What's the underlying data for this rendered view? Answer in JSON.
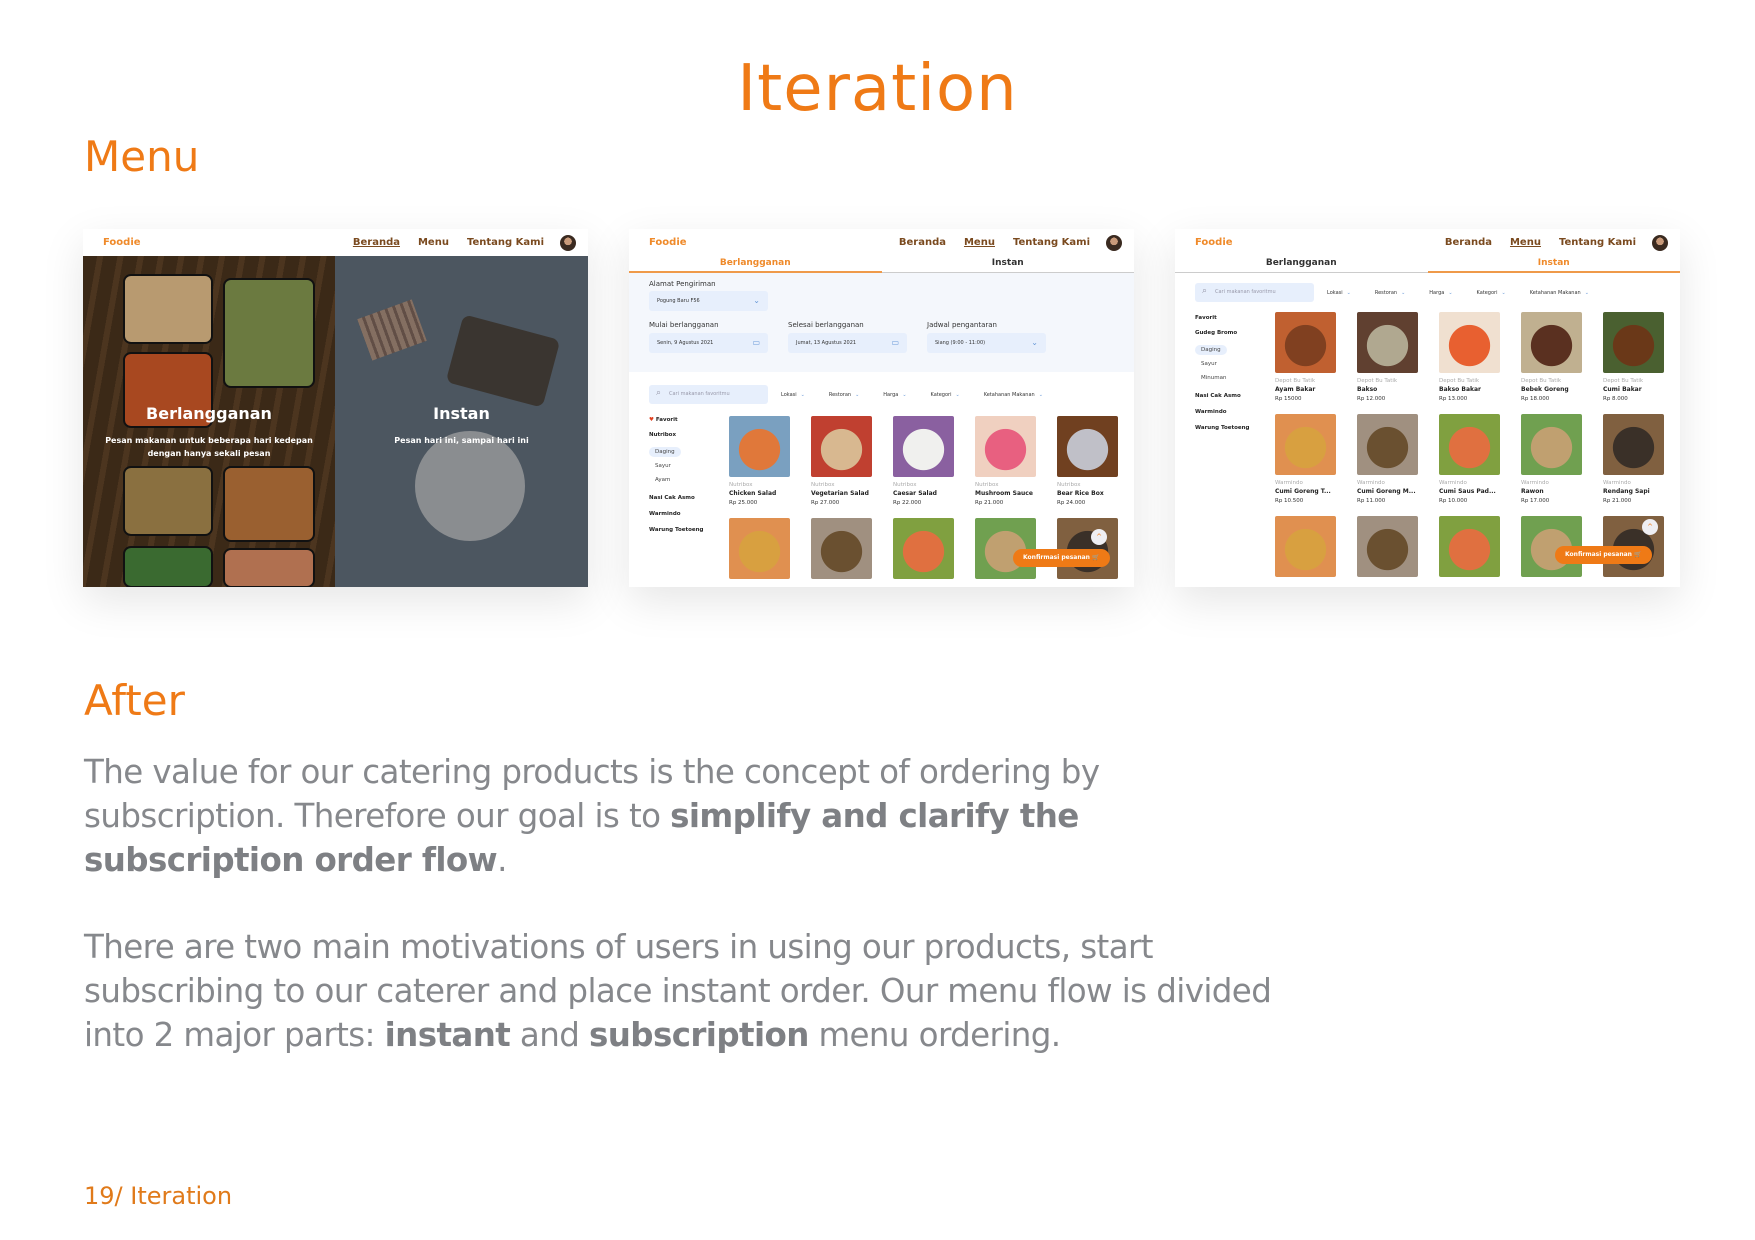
{
  "page": {
    "title": "Iteration",
    "section_menu": "Menu",
    "section_after": "After",
    "footer": "19/ Iteration",
    "accent_color": "#ef7a16"
  },
  "paragraph1": {
    "part1": "The value for our catering products is the concept of ordering by subscription. Therefore our goal is to ",
    "bold1": "simplify and clarify the subscription order flow",
    "part2": "."
  },
  "paragraph2": {
    "part1": "There are two main motivations of users in using our products, start subscribing to our caterer and place instant order. Our menu flow is divided into 2 major parts: ",
    "bold1": "instant",
    "part2": " and ",
    "bold2": "subscription",
    "part3": " menu ordering."
  },
  "app": {
    "logo": "Foodie",
    "nav": [
      "Beranda",
      "Menu",
      "Tentang Kami"
    ],
    "avatar_icon": "user-avatar"
  },
  "screen1": {
    "active_nav": "Beranda",
    "left": {
      "title": "Berlangganan",
      "subtitle": "Pesan makanan untuk beberapa hari kedepan dengan hanya sekali pesan"
    },
    "right": {
      "title": "Instan",
      "subtitle": "Pesan hari ini, sampai hari ini"
    }
  },
  "screen2": {
    "active_nav": "Menu",
    "tabs": [
      "Berlangganan",
      "Instan"
    ],
    "active_tab": "Berlangganan",
    "form": {
      "address_label": "Alamat Pengiriman",
      "address_value": "Pogung Baru F56",
      "start_label": "Mulai berlangganan",
      "start_value": "Senin, 9 Agustus 2021",
      "end_label": "Selesai berlangganan",
      "end_value": "Jumat, 13 Agustus 2021",
      "schedule_label": "Jadwal pengantaran",
      "schedule_value": "Siang (9:00 - 11:00)"
    },
    "search_placeholder": "Cari makanan favoritmu",
    "filters": [
      "Lokasi",
      "Restoran",
      "Harga",
      "Kategori",
      "Ketahanan Makanan"
    ],
    "sidebar": {
      "favorite": "Favorit",
      "groups": [
        {
          "name": "Nutribox",
          "subs": [
            "Daging",
            "Sayur",
            "Ayam"
          ],
          "selected": "Daging"
        },
        {
          "name": "Nasi Cak Asmo",
          "subs": []
        },
        {
          "name": "Warmindo",
          "subs": []
        },
        {
          "name": "Warung Toetoeng",
          "subs": []
        }
      ]
    },
    "products": [
      {
        "restaurant": "Nutribox",
        "name": "Chicken Salad",
        "price": "Rp 25.000"
      },
      {
        "restaurant": "Nutribox",
        "name": "Vegetarian Salad",
        "price": "Rp 27.000"
      },
      {
        "restaurant": "Nutribox",
        "name": "Caesar Salad",
        "price": "Rp 22.000"
      },
      {
        "restaurant": "Nutribox",
        "name": "Mushroom Sauce",
        "price": "Rp 21.000"
      },
      {
        "restaurant": "Nutribox",
        "name": "Bear Rice Box",
        "price": "Rp 24.000"
      }
    ],
    "confirm_label": "Konfirmasi pesanan"
  },
  "screen3": {
    "active_nav": "Menu",
    "tabs": [
      "Berlangganan",
      "Instan"
    ],
    "active_tab": "Instan",
    "search_placeholder": "Cari makanan favoritmu",
    "filters": [
      "Lokasi",
      "Restoran",
      "Harga",
      "Kategori",
      "Ketahanan Makanan"
    ],
    "sidebar": {
      "favorite": "Favorit",
      "groups": [
        {
          "name": "Gudeg Bromo",
          "subs": [
            "Daging",
            "Sayur",
            "Minuman"
          ],
          "selected": "Daging"
        },
        {
          "name": "Nasi Cak Asmo",
          "subs": []
        },
        {
          "name": "Warmindo",
          "subs": []
        },
        {
          "name": "Warung Toetoeng",
          "subs": []
        }
      ]
    },
    "products": [
      {
        "restaurant": "Depot Bu Tatik",
        "name": "Ayam Bakar",
        "price": "Rp 15000"
      },
      {
        "restaurant": "Depot Bu Tatik",
        "name": "Bakso",
        "price": "Rp 12.000"
      },
      {
        "restaurant": "Depot Bu Tatik",
        "name": "Bakso Bakar",
        "price": "Rp 13.000"
      },
      {
        "restaurant": "Depot Bu Tatik",
        "name": "Bebek Goreng",
        "price": "Rp 18.000"
      },
      {
        "restaurant": "Depot Bu Tatik",
        "name": "Cumi Bakar",
        "price": "Rp 8.000"
      },
      {
        "restaurant": "Warmindo",
        "name": "Cumi Goreng T...",
        "price": "Rp 10.500"
      },
      {
        "restaurant": "Warmindo",
        "name": "Cumi Goreng M...",
        "price": "Rp 11.000"
      },
      {
        "restaurant": "Warmindo",
        "name": "Cumi Saus Pad...",
        "price": "Rp 10.000"
      },
      {
        "restaurant": "Warmindo",
        "name": "Rawon",
        "price": "Rp 17.000"
      },
      {
        "restaurant": "Warmindo",
        "name": "Rendang Sapi",
        "price": "Rp 21.000"
      }
    ],
    "confirm_label": "Konfirmasi pesanan"
  }
}
